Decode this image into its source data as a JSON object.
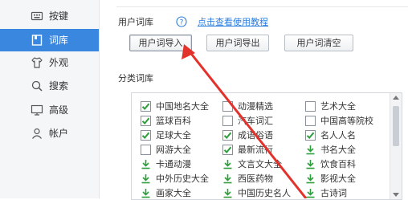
{
  "colors": {
    "accent": "#3a87e0",
    "link": "#2b7de0",
    "check_green": "#2e9e3c",
    "arrow_red": "#e3322b"
  },
  "sidebar": {
    "items": [
      {
        "label": "按键",
        "icon": "keyboard-icon",
        "active": false
      },
      {
        "label": "词库",
        "icon": "book-icon",
        "active": true
      },
      {
        "label": "外观",
        "icon": "shirt-icon",
        "active": false
      },
      {
        "label": "搜索",
        "icon": "search-icon",
        "active": false
      },
      {
        "label": "高级",
        "icon": "monitor-icon",
        "active": false
      },
      {
        "label": "帐户",
        "icon": "user-icon",
        "active": false
      }
    ]
  },
  "user_dict": {
    "title": "用户词库",
    "help_link": "点击查看使用教程",
    "buttons": {
      "import": "用户词导入",
      "export": "用户词导出",
      "clear": "用户词清空"
    }
  },
  "category": {
    "title": "分类词库",
    "items": [
      {
        "label": "中国地名大全",
        "state": "checked"
      },
      {
        "label": "动漫精选",
        "state": "unchecked"
      },
      {
        "label": "艺术大全",
        "state": "unchecked"
      },
      {
        "label": "篮球百科",
        "state": "checked"
      },
      {
        "label": "汽车词汇",
        "state": "unchecked"
      },
      {
        "label": "中国高等院校",
        "state": "unchecked"
      },
      {
        "label": "足球大全",
        "state": "checked"
      },
      {
        "label": "成语俗语",
        "state": "checked"
      },
      {
        "label": "名人人名",
        "state": "checked"
      },
      {
        "label": "网游大全",
        "state": "unchecked"
      },
      {
        "label": "最新流行",
        "state": "checked"
      },
      {
        "label": "书名大全",
        "state": "download"
      },
      {
        "label": "卡通动漫",
        "state": "download"
      },
      {
        "label": "文言文大全",
        "state": "download"
      },
      {
        "label": "饮食百科",
        "state": "download"
      },
      {
        "label": "中外历史大全",
        "state": "download"
      },
      {
        "label": "西医药物",
        "state": "download"
      },
      {
        "label": "影视大全",
        "state": "download"
      },
      {
        "label": "画家大全",
        "state": "download"
      },
      {
        "label": "中国历史名人",
        "state": "download"
      },
      {
        "label": "古诗词",
        "state": "download"
      }
    ]
  }
}
